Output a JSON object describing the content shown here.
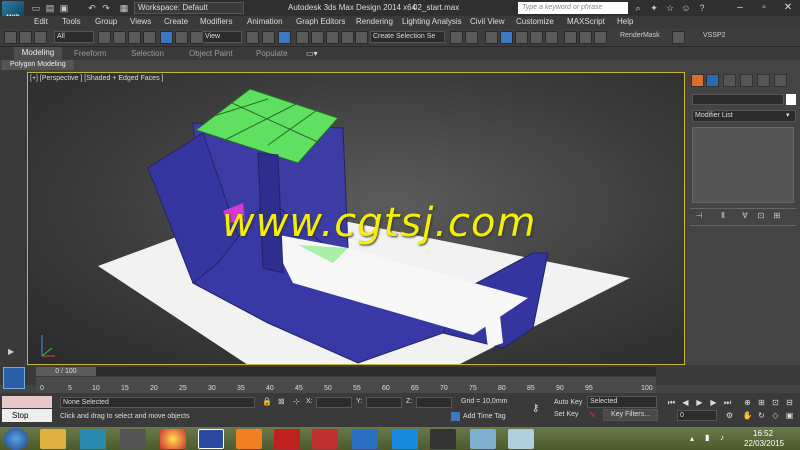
{
  "titlebar": {
    "app_logo_text": "MXD",
    "workspace": "Workspace: Default",
    "title": "Autodesk 3ds Max Design 2014 x64",
    "file": "02_start.max",
    "search_placeholder": "Type a keyword or phrase",
    "quick_access_icons": [
      "new-icon",
      "open-icon",
      "save-icon",
      "undo-icon",
      "redo-icon",
      "hold-icon"
    ]
  },
  "menu": {
    "items": [
      "Edit",
      "Tools",
      "Group",
      "Views",
      "Create",
      "Modifiers",
      "Animation",
      "Graph Editors",
      "Rendering",
      "Lighting Analysis",
      "Civil View",
      "Customize",
      "MAXScript",
      "Help"
    ]
  },
  "toolbar": {
    "filter": "All",
    "coord_system": "View",
    "selection_set": "Create Selection Se",
    "render_mask": "RenderMask",
    "vssp": "VSSP2"
  },
  "ribbon": {
    "tabs": [
      "Modeling",
      "Freeform",
      "Selection",
      "Object Paint",
      "Populate"
    ],
    "panel": "Polygon Modeling"
  },
  "viewport": {
    "label": "[+] [Perspective ] [Shaded + Edged Faces ]",
    "watermark": "www.cgtsj.com",
    "colors": {
      "walls": "#3c3ca4",
      "top": "#60e060",
      "floor": "#f2f2f2",
      "frame": "#c8b430"
    }
  },
  "command_panel": {
    "modifier_list": "Modifier List",
    "tab_icons": [
      "sun-icon",
      "modify-icon",
      "hierarchy-icon",
      "motion-icon",
      "display-icon",
      "utilities-icon"
    ]
  },
  "timeline": {
    "slider_label": "0 / 100",
    "ticks": [
      "0",
      "5",
      "10",
      "15",
      "20",
      "25",
      "30",
      "35",
      "40",
      "45",
      "50",
      "55",
      "60",
      "65",
      "70",
      "75",
      "80",
      "85",
      "90",
      "95",
      "100"
    ]
  },
  "status": {
    "stop_label": "Stop",
    "selection": "None Selected",
    "prompt": "Click and drag to select and move objects",
    "x_label": "X:",
    "y_label": "Y:",
    "z_label": "Z:",
    "grid": "Grid = 10,0mm",
    "add_time_tag": "Add Time Tag",
    "auto_key": "Auto Key",
    "selected": "Selected",
    "set_key": "Set Key",
    "key_filters": "Key Filters...",
    "frame": "0"
  },
  "taskbar": {
    "time": "16:52",
    "date": "22/03/2015"
  }
}
